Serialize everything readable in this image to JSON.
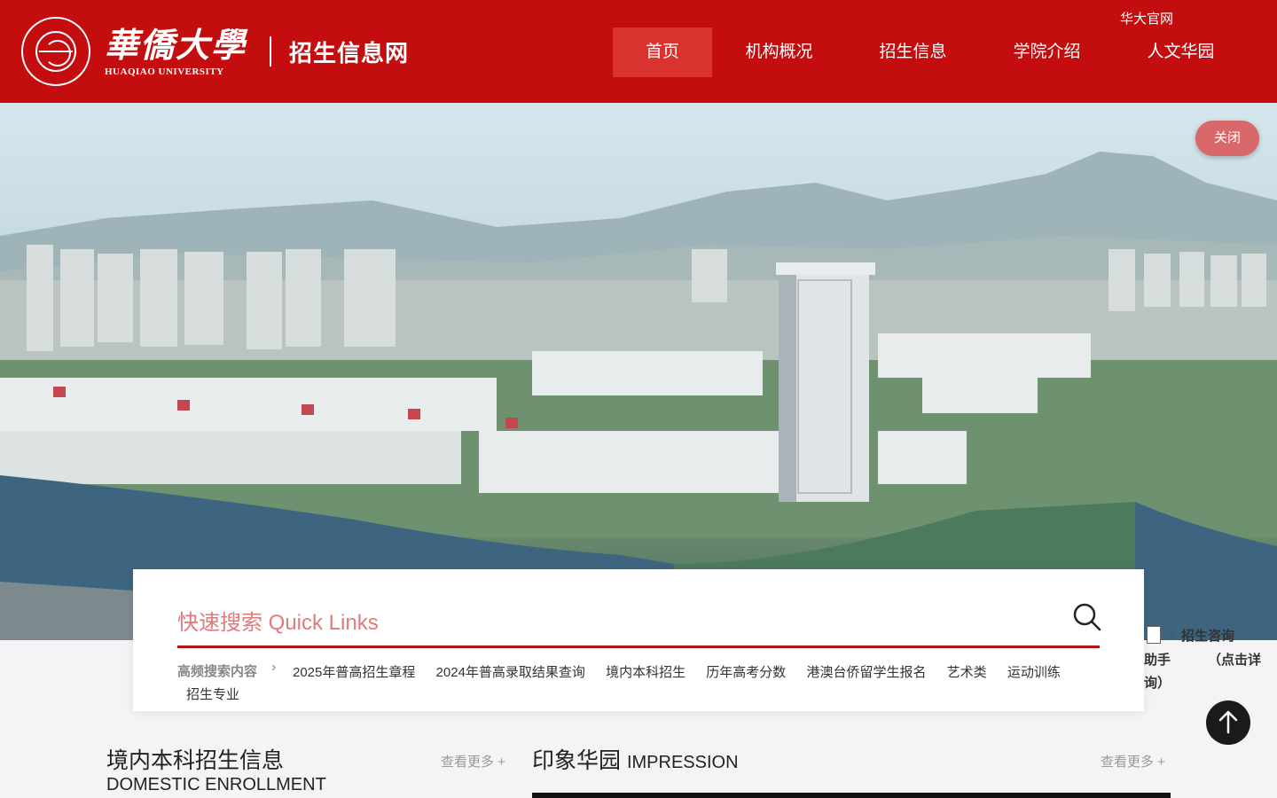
{
  "header": {
    "logo_cn": "華僑大學",
    "logo_en": "HUAQIAO UNIVERSITY",
    "site_name": "招生信息网",
    "top_link": "华大官网",
    "nav": [
      {
        "label": "首页",
        "active": true
      },
      {
        "label": "机构概况",
        "active": false
      },
      {
        "label": "招生信息",
        "active": false
      },
      {
        "label": "学院介绍",
        "active": false
      },
      {
        "label": "人文华园",
        "active": false
      }
    ],
    "brand_color": "#c30d0f",
    "active_nav_color": "#d9322f"
  },
  "hero": {
    "close_label": "关闭"
  },
  "search": {
    "title": "快速搜索 Quick Links",
    "hot_label": "高频搜索内容",
    "hot_items": [
      "2025年普高招生章程",
      "2024年普高录取结果查询",
      "境内本科招生",
      "历年高考分数",
      "港澳台侨留学生报名",
      "艺术类",
      "运动训练",
      "招生专业"
    ]
  },
  "helper": {
    "close": "×",
    "line1": "招生咨询",
    "line2": "助手",
    "line3": "（点击详",
    "line4": "询）"
  },
  "sections": {
    "domestic_title": "境内本科招生信息",
    "domestic_sub": "DOMESTIC ENROLLMENT",
    "more_label": "查看更多 +",
    "impression_title": "印象华园",
    "impression_en": "IMPRESSION"
  }
}
